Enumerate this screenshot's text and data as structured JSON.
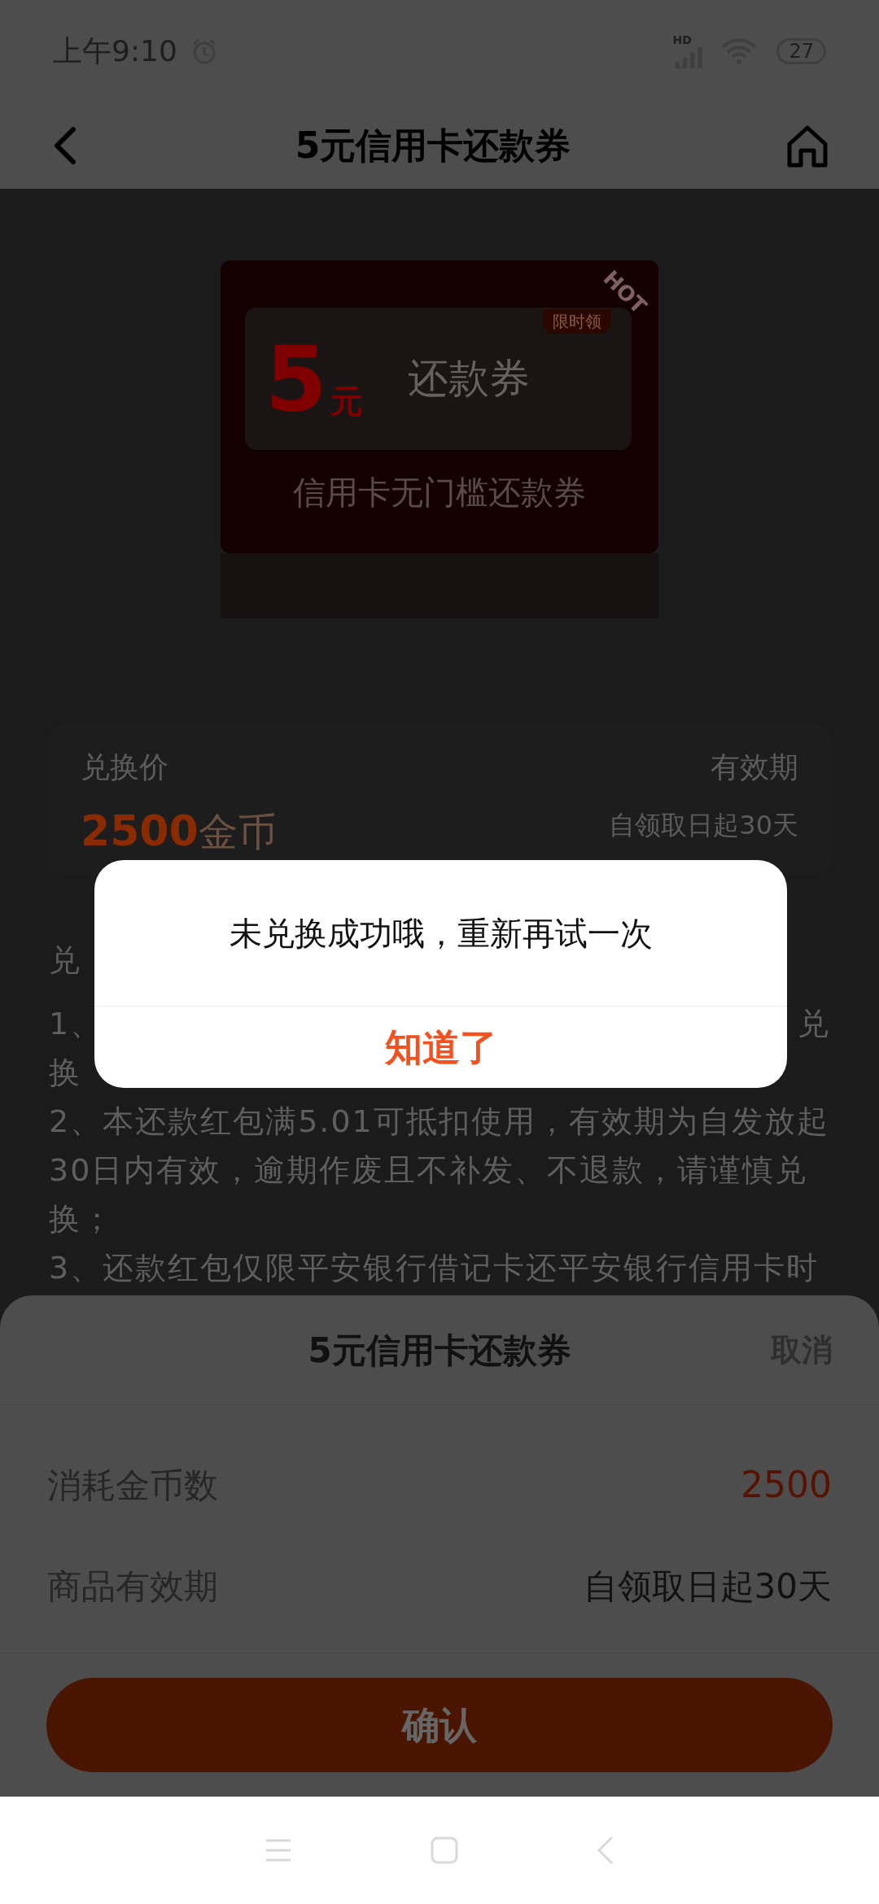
{
  "status_bar": {
    "time": "上午9:10",
    "network": "HD",
    "battery": "27"
  },
  "header": {
    "title": "5元信用卡还款券"
  },
  "coupon": {
    "amount": "5",
    "unit": "元",
    "name": "还款券",
    "tag": "限时领",
    "ribbon": "HOT",
    "subtitle": "信用卡无门槛还款券"
  },
  "info_card": {
    "price_label": "兑换价",
    "price": "2500",
    "price_unit": "金币",
    "validity_label": "有效期",
    "validity": "自领取日起30天"
  },
  "rules": {
    "heading": "兑",
    "lines": [
      {
        "left": "1、",
        "right": "兑"
      },
      {
        "left": "换"
      },
      {
        "left": "2、本还款红包满5.01可抵扣使用，有效期为自发放起"
      },
      {
        "left": "30日内有效，逾期作废且不补发、不退款，请谨慎兑"
      },
      {
        "left": "换；"
      },
      {
        "left": "3、还款红包仅限平安银行借记卡还平安银行信用卡时"
      }
    ]
  },
  "dialog": {
    "message": "未兑换成功哦，重新再试一次",
    "button": "知道了"
  },
  "sheet": {
    "title": "5元信用卡还款券",
    "cancel": "取消",
    "rows": [
      {
        "kind": "price",
        "label": "消耗金币数",
        "value": "2500"
      },
      {
        "kind": "text",
        "label": "商品有效期",
        "value": "自领取日起30天"
      }
    ],
    "confirm": "确认"
  }
}
